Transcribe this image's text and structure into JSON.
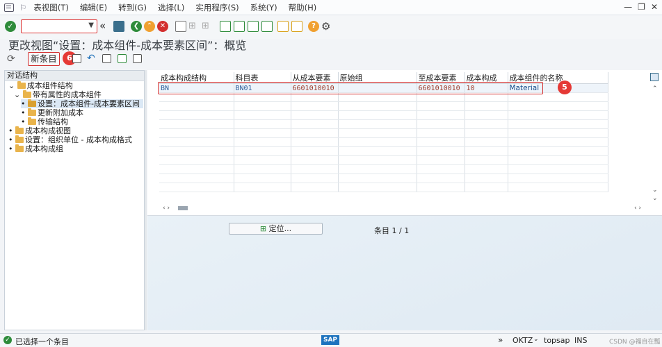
{
  "menu": {
    "items": [
      "表视图(T)",
      "编辑(E)",
      "转到(G)",
      "选择(L)",
      "实用程序(S)",
      "系统(Y)",
      "帮助(H)"
    ]
  },
  "window_controls": [
    "—",
    "❐",
    "✕"
  ],
  "page_title": "更改视图“设置：成本组件-成本要素区间”：概览",
  "app_toolbar": {
    "new_entry_label": "新条目",
    "badge_new": "6"
  },
  "dialog_structure": {
    "header": "对话结构",
    "items": [
      {
        "label": "成本组件结构",
        "level": 0
      },
      {
        "label": "带有属性的成本组件",
        "level": 1
      },
      {
        "label": "设置：成本组件-成本要素区间",
        "level": 2,
        "selected": true
      },
      {
        "label": "更新附加成本",
        "level": 2
      },
      {
        "label": "传输结构",
        "level": 2
      },
      {
        "label": "成本构成视图",
        "level": 0
      },
      {
        "label": "设置：组织单位 - 成本构成格式",
        "level": 0
      },
      {
        "label": "成本构成组",
        "level": 0
      }
    ]
  },
  "table": {
    "columns": [
      "成本构成结构",
      "科目表",
      "从成本要素",
      "原始组",
      "至成本要素",
      "成本构成",
      "成本组件的名称"
    ],
    "rows": [
      [
        "BN",
        "BN01",
        "6601010010",
        "",
        "6601010010",
        "10",
        "Material"
      ]
    ],
    "badge_row": "5"
  },
  "locate_button": "定位...",
  "entries_label": "条目 1 / 1",
  "status": {
    "message": "已选择一个条目",
    "sap_logo": "SAP",
    "tcode": "OKTZ",
    "server": "topsap",
    "mode": "INS",
    "watermark": "CSDN @福自在瓢"
  },
  "colors": {
    "accent_red": "#d32f2f",
    "green_check": "#2e8b3a",
    "orange": "#f0a030"
  }
}
